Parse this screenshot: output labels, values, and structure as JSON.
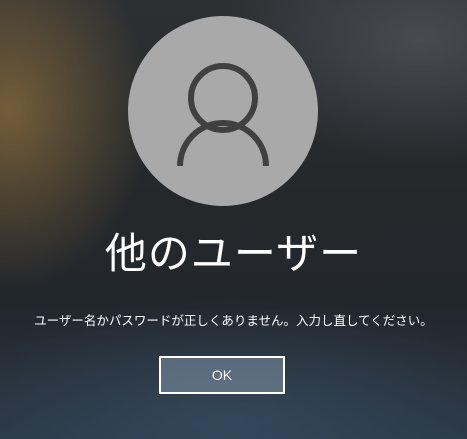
{
  "login": {
    "user_name": "他のユーザー",
    "error_message": "ユーザー名かパスワードが正しくありません。入力し直してください。",
    "ok_label": "OK"
  },
  "icons": {
    "avatar": "user-silhouette-icon"
  },
  "colors": {
    "avatar_bg": "#a9a9a9",
    "avatar_icon": "#404040",
    "button_border": "#ffffff"
  }
}
